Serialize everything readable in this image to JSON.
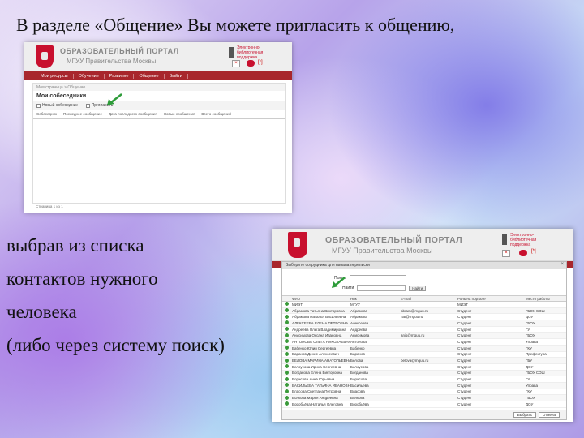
{
  "caption_top": "В разделе «Общение» Вы можете пригласить к общению,",
  "caption_lines": [
    "выбрав из списка",
    "контактов нужного",
    "человека",
    "(либо через систему поиск)"
  ],
  "portal": {
    "title": "ОБРАЗОВАТЕЛЬНЫЙ ПОРТАЛ",
    "subtitle": "МГУУ Правительства Москвы",
    "header_link": "Электронно-библиотечная поддержка",
    "message_count": "[*]"
  },
  "screenshot1": {
    "nav_items": [
      "Мои ресурсы",
      "Обучение",
      "Развитие",
      "Общение",
      "Выйти"
    ],
    "breadcrumb": "Моя страница > Общение",
    "page_title": "Мои собеседники",
    "tools": [
      "Новый собеседник",
      "Пригласить"
    ],
    "columns": [
      "Собеседник",
      "Последнее сообщение",
      "Дата последнего сообщения",
      "Новые сообщения",
      "Всего сообщений"
    ],
    "footer": "Страница 1 из 1"
  },
  "screenshot2": {
    "dialog_title": "Выберите сотрудника для начала переписки",
    "search_label": "Поиск:",
    "find_label": "Найти",
    "search_button": "Найти",
    "columns": [
      "ФИО",
      "Ник",
      "E-mail",
      "Роль на портале",
      "Место работы"
    ],
    "rows": [
      [
        "МИЭТ",
        "МГУУ",
        "",
        "МИЭТ",
        ""
      ],
      [
        "Абрамова Татьяна Викторовна",
        "Абрамова",
        "abram@mguu.ru",
        "Студент",
        "ГБОУ СОШ"
      ],
      [
        "Абрамова Наталья Васильевна",
        "Абрамова",
        "nat@mguu.ru",
        "Студент",
        "ДОУ"
      ],
      [
        "АЛЕКСЕЕВА ЕЛЕНА ПЕТРОВНА",
        "Алексеева",
        "",
        "Студент",
        "ГБОУ"
      ],
      [
        "Андреева Ольга Владимировна",
        "Андреева",
        "",
        "Студент",
        "ГУ"
      ],
      [
        "Анисимова Оксана Ивановна",
        "Анисимова",
        "anis@mguu.ru",
        "Студент",
        "ГБОУ"
      ],
      [
        "АНТОНОВА ОЛЬГА НИКОЛАЕВНА",
        "Антонова",
        "",
        "Студент",
        "Управа"
      ],
      [
        "Бабенко Юлия Сергеевна",
        "Бабенко",
        "",
        "Студент",
        "ГКУ"
      ],
      [
        "Баранов Денис Алексеевич",
        "Баранов",
        "",
        "Студент",
        "Префектура"
      ],
      [
        "БЕЛОВА МАРИНА АНАТОЛЬЕВНА",
        "Белова",
        "belova@mguu.ru",
        "Студент",
        "ГБУ"
      ],
      [
        "Белоусова Ирина Сергеевна",
        "Белоусова",
        "",
        "Студент",
        "ДОУ"
      ],
      [
        "Богданова Елена Викторовна",
        "Богданова",
        "",
        "Студент",
        "ГБОУ СОШ"
      ],
      [
        "Борисова Анна Юрьевна",
        "Борисова",
        "",
        "Студент",
        "ГУ"
      ],
      [
        "ВАСИЛЬЕВА ТАТЬЯНА ИВАНОВНА",
        "Васильева",
        "",
        "Студент",
        "Управа"
      ],
      [
        "Власова Светлана Петровна",
        "Власова",
        "",
        "Студент",
        "ГКУ"
      ],
      [
        "Волкова Мария Андреевна",
        "Волкова",
        "",
        "Студент",
        "ГБОУ"
      ],
      [
        "Воробьёва Наталья Олеговна",
        "Воробьёва",
        "",
        "Студент",
        "ДОУ"
      ]
    ],
    "footer_buttons": [
      "Выбрать",
      "Отмена"
    ]
  },
  "colors": {
    "brand_red": "#a8262c",
    "crest_red": "#c8102e",
    "arrow_green": "#2e9c3a"
  }
}
